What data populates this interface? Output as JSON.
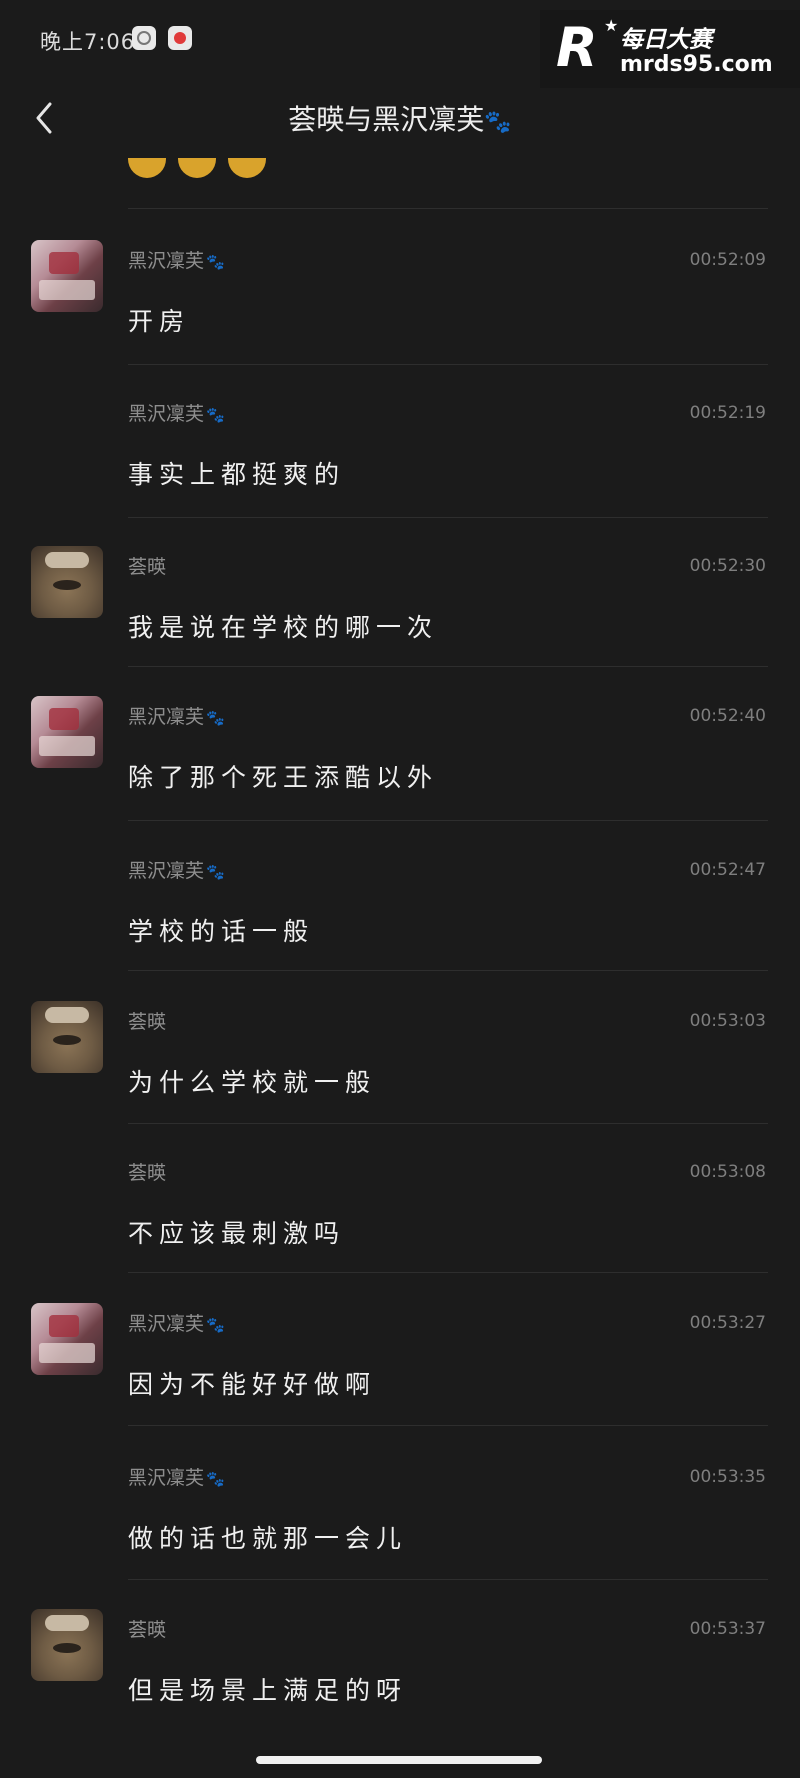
{
  "status_bar": {
    "time": "晚上7:06"
  },
  "watermark": {
    "brand_cn": "每日大赛",
    "url": "mrds95.com"
  },
  "header": {
    "title": "荟暎与黑沢凜芙",
    "title_paw": "🐾"
  },
  "messages": [
    {
      "sender": "黑沢凜芙",
      "paw": "🐾",
      "time": "00:52:09",
      "text": "开房",
      "avatar": "girl-photo"
    },
    {
      "sender": "黑沢凜芙",
      "paw": "🐾",
      "time": "00:52:19",
      "text": "事实上都挺爽的",
      "avatar": ""
    },
    {
      "sender": "荟暎",
      "paw": "",
      "time": "00:52:30",
      "text": "我是说在学校的哪一次",
      "avatar": "cat-photo"
    },
    {
      "sender": "黑沢凜芙",
      "paw": "🐾",
      "time": "00:52:40",
      "text": "除了那个死王添酷以外",
      "avatar": "girl-photo"
    },
    {
      "sender": "黑沢凜芙",
      "paw": "🐾",
      "time": "00:52:47",
      "text": "学校的话一般",
      "avatar": ""
    },
    {
      "sender": "荟暎",
      "paw": "",
      "time": "00:53:03",
      "text": "为什么学校就一般",
      "avatar": "cat-photo"
    },
    {
      "sender": "荟暎",
      "paw": "",
      "time": "00:53:08",
      "text": "不应该最刺激吗",
      "avatar": ""
    },
    {
      "sender": "黑沢凜芙",
      "paw": "🐾",
      "time": "00:53:27",
      "text": "因为不能好好做啊",
      "avatar": "girl-photo"
    },
    {
      "sender": "黑沢凜芙",
      "paw": "🐾",
      "time": "00:53:35",
      "text": "做的话也就那一会儿",
      "avatar": ""
    },
    {
      "sender": "荟暎",
      "paw": "",
      "time": "00:53:37",
      "text": "但是场景上满足的呀",
      "avatar": "cat-photo"
    }
  ]
}
